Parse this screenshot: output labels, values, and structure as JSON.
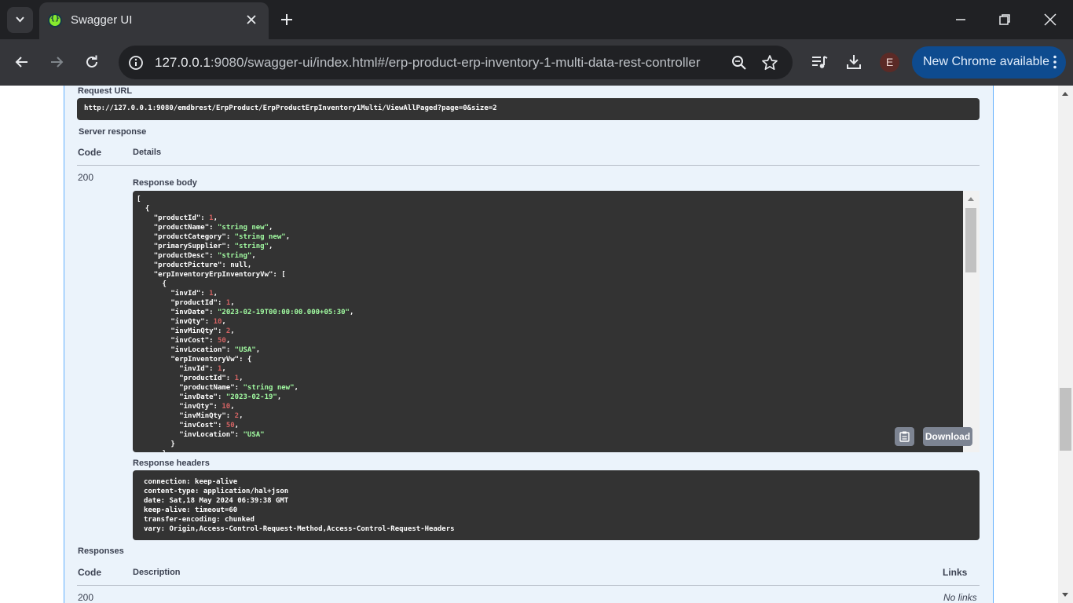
{
  "browser": {
    "tab_title": "Swagger UI",
    "url_host": "127.0.0.1",
    "url_rest": ":9080/swagger-ui/index.html#/erp-product-erp-inventory-1-multi-data-rest-controller",
    "avatar_letter": "E",
    "update_label": "New Chrome available"
  },
  "icons": {
    "tab_search": "chevron-down-icon",
    "favicon": "swagger-icon",
    "tab_close": "close-icon",
    "new_tab": "plus-icon",
    "minimize": "minimize-icon",
    "restore": "restore-icon",
    "close_window": "close-icon",
    "back": "back-arrow-icon",
    "forward": "forward-arrow-icon",
    "reload": "reload-icon",
    "site_info": "info-icon",
    "zoom": "zoom-icon",
    "bookmark": "star-icon",
    "media": "media-control-icon",
    "downloads": "download-icon",
    "menu": "more-vert-icon",
    "copy": "clipboard-icon"
  },
  "colors": {
    "accent_get": "#61affe",
    "block_bg": "#ebf3fb",
    "code_bg": "#333333",
    "json_string": "#a2fca2",
    "json_number": "#d36363"
  },
  "request": {
    "label": "Request URL",
    "url": "http://127.0.0.1:9080/emdbrest/ErpProduct/ErpProductErpInventory1Multi/ViewAllPaged?page=0&size=2"
  },
  "server_response": {
    "label": "Server response",
    "col_code": "Code",
    "col_details": "Details",
    "code": "200",
    "body_label": "Response body",
    "body_lines": [
      "[",
      "  {",
      "    \"productId\": 1,",
      "    \"productName\": \"string new\",",
      "    \"productCategory\": \"string new\",",
      "    \"primarySupplier\": \"string\",",
      "    \"productDesc\": \"string\",",
      "    \"productPicture\": null,",
      "    \"erpInventoryErpInventoryVw\": [",
      "      {",
      "        \"invId\": 1,",
      "        \"productId\": 1,",
      "        \"invDate\": \"2023-02-19T00:00:00.000+05:30\",",
      "        \"invQty\": 10,",
      "        \"invMinQty\": 2,",
      "        \"invCost\": 50,",
      "        \"invLocation\": \"USA\",",
      "        \"erpInventoryVw\": {",
      "          \"invId\": 1,",
      "          \"productId\": 1,",
      "          \"productName\": \"string new\",",
      "          \"invDate\": \"2023-02-19\",",
      "          \"invQty\": 10,",
      "          \"invMinQty\": 2,",
      "          \"invCost\": 50,",
      "          \"invLocation\": \"USA\"",
      "        }",
      "      },"
    ],
    "download_label": "Download",
    "headers_label": "Response headers",
    "headers_lines": [
      "connection: keep-alive",
      "content-type: application/hal+json",
      "date: Sat,18 May 2024 06:39:38 GMT",
      "keep-alive: timeout=60",
      "transfer-encoding: chunked",
      "vary: Origin,Access-Control-Request-Method,Access-Control-Request-Headers"
    ]
  },
  "responses": {
    "label": "Responses",
    "col_code": "Code",
    "col_description": "Description",
    "col_links": "Links",
    "code": "200",
    "links_value": "No links"
  }
}
